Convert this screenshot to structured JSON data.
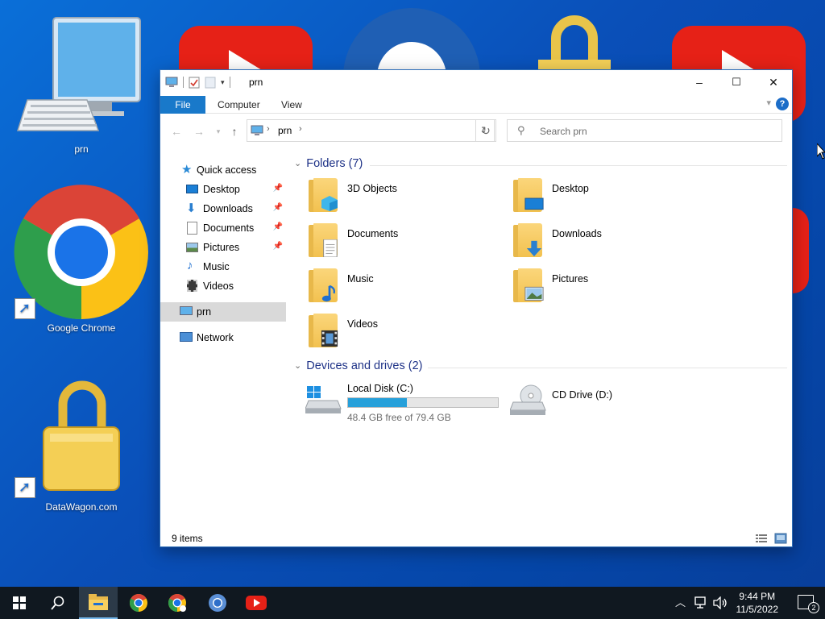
{
  "desktop": {
    "icons": [
      {
        "label": "prn",
        "icon": "computer-icon"
      },
      {
        "label": "Google Chrome",
        "icon": "chrome-icon"
      },
      {
        "label": "DataWagon.com",
        "icon": "lock-icon"
      }
    ]
  },
  "window": {
    "title": "prn",
    "controls": {
      "minimize": "–",
      "maximize": "☐",
      "close": "✕"
    },
    "ribbon_tabs": [
      "File",
      "Computer",
      "View"
    ],
    "help": "?",
    "address": {
      "crumb": "prn"
    },
    "search": {
      "placeholder": "Search prn"
    },
    "nav": [
      {
        "label": "Quick access",
        "icon": "star-icon"
      },
      {
        "label": "Desktop",
        "icon": "desktop-icon",
        "pinned": true
      },
      {
        "label": "Downloads",
        "icon": "download-icon",
        "pinned": true
      },
      {
        "label": "Documents",
        "icon": "documents-icon",
        "pinned": true
      },
      {
        "label": "Pictures",
        "icon": "pictures-icon",
        "pinned": true
      },
      {
        "label": "Music",
        "icon": "music-icon"
      },
      {
        "label": "Videos",
        "icon": "videos-icon"
      },
      {
        "label": "prn",
        "icon": "computer-icon",
        "selected": true
      },
      {
        "label": "Network",
        "icon": "network-icon"
      }
    ],
    "folders_header": "Folders (7)",
    "folders": [
      {
        "name": "3D Objects",
        "icon": "3d-objects-icon"
      },
      {
        "name": "Desktop",
        "icon": "desktop-icon"
      },
      {
        "name": "Documents",
        "icon": "documents-icon"
      },
      {
        "name": "Downloads",
        "icon": "download-icon"
      },
      {
        "name": "Music",
        "icon": "music-icon"
      },
      {
        "name": "Pictures",
        "icon": "pictures-icon"
      },
      {
        "name": "Videos",
        "icon": "videos-icon"
      }
    ],
    "drives_header": "Devices and drives (2)",
    "drives": [
      {
        "name": "Local Disk (C:)",
        "free_text": "48.4 GB free of 79.4 GB",
        "used_fraction": 0.39,
        "icon": "hard-drive-icon"
      },
      {
        "name": "CD Drive (D:)",
        "icon": "cd-drive-icon"
      }
    ],
    "status": {
      "items": "9 items"
    }
  },
  "taskbar": {
    "time": "9:44 PM",
    "date": "11/5/2022",
    "notifications": "2",
    "apps": [
      "start-icon",
      "search-icon",
      "file-explorer-icon",
      "chrome-icon",
      "chrome-beta-icon",
      "chromium-icon",
      "youtube-icon"
    ]
  },
  "colors": {
    "accent": "#1979ca",
    "desktop": "#0a5fc8",
    "taskbar": "#101820",
    "folder": "#f2c14f"
  }
}
